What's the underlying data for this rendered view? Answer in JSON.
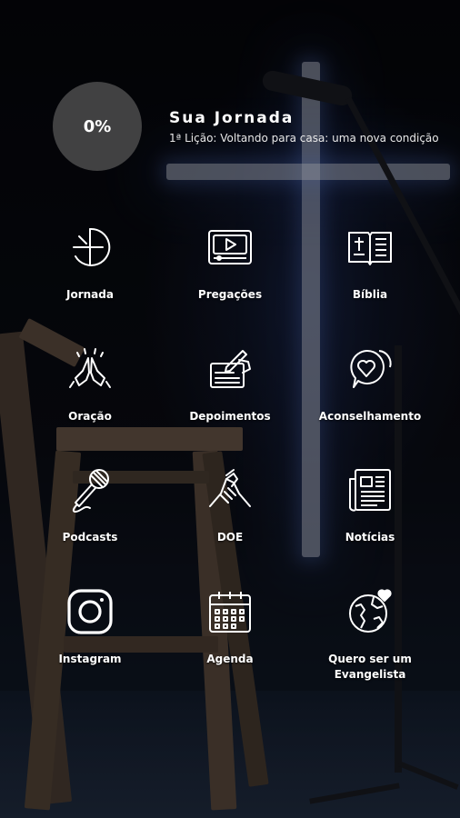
{
  "journey": {
    "progress": "0%",
    "progress_value": 0,
    "title": "Sua Jornada",
    "lesson": "1ª Lição: Voltando para casa: uma nova condição"
  },
  "menu": [
    {
      "label": "Jornada",
      "icon": "compass-cross-icon"
    },
    {
      "label": "Pregações",
      "icon": "video-play-icon"
    },
    {
      "label": "Bíblia",
      "icon": "bible-icon"
    },
    {
      "label": "Oração",
      "icon": "praying-hands-icon"
    },
    {
      "label": "Depoimentos",
      "icon": "writing-hand-icon"
    },
    {
      "label": "Aconselhamento",
      "icon": "heart-chat-icon"
    },
    {
      "label": "Podcasts",
      "icon": "microphone-icon"
    },
    {
      "label": "DOE",
      "icon": "handshake-icon"
    },
    {
      "label": "Notícias",
      "icon": "newspaper-icon"
    },
    {
      "label": "Instagram",
      "icon": "instagram-icon"
    },
    {
      "label": "Agenda",
      "icon": "calendar-icon"
    },
    {
      "label": "Quero ser um Evangelista",
      "icon": "globe-heart-icon"
    }
  ]
}
